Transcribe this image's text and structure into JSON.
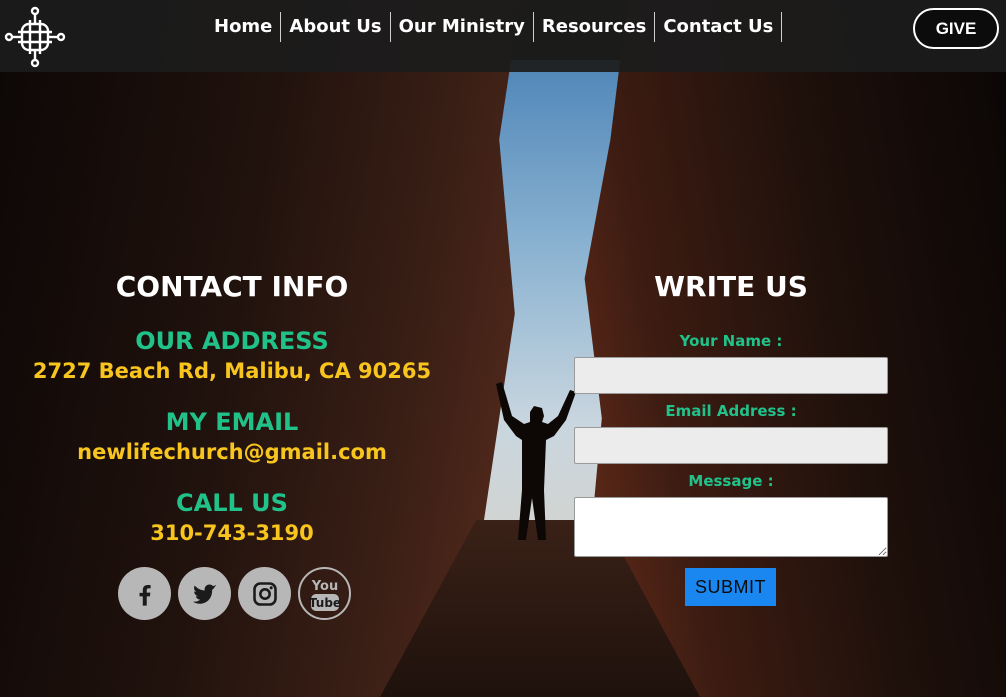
{
  "header": {
    "nav": [
      "Home",
      "About Us",
      "Our Ministry",
      "Resources",
      "Contact Us"
    ],
    "give_label": "GIVE"
  },
  "contact_info": {
    "heading": "CONTACT INFO",
    "address_title": "OUR ADDRESS",
    "address": "2727 Beach Rd, Malibu, CA 90265",
    "email_title": "MY EMAIL",
    "email": "newlifechurch@gmail.com",
    "call_title": "CALL US",
    "phone": "310-743-3190",
    "socials": [
      "facebook-icon",
      "twitter-icon",
      "instagram-icon",
      "youtube-icon"
    ]
  },
  "write_us": {
    "heading": "WRITE US",
    "name_label": "Your Name :",
    "name_value": "",
    "email_label": "Email Address :",
    "email_value": "",
    "message_label": "Message :",
    "message_value": "",
    "submit_label": "SUBMIT"
  },
  "colors": {
    "accent_green": "#21c28a",
    "accent_yellow": "#f7c51e",
    "button_blue": "#1a86f0"
  }
}
